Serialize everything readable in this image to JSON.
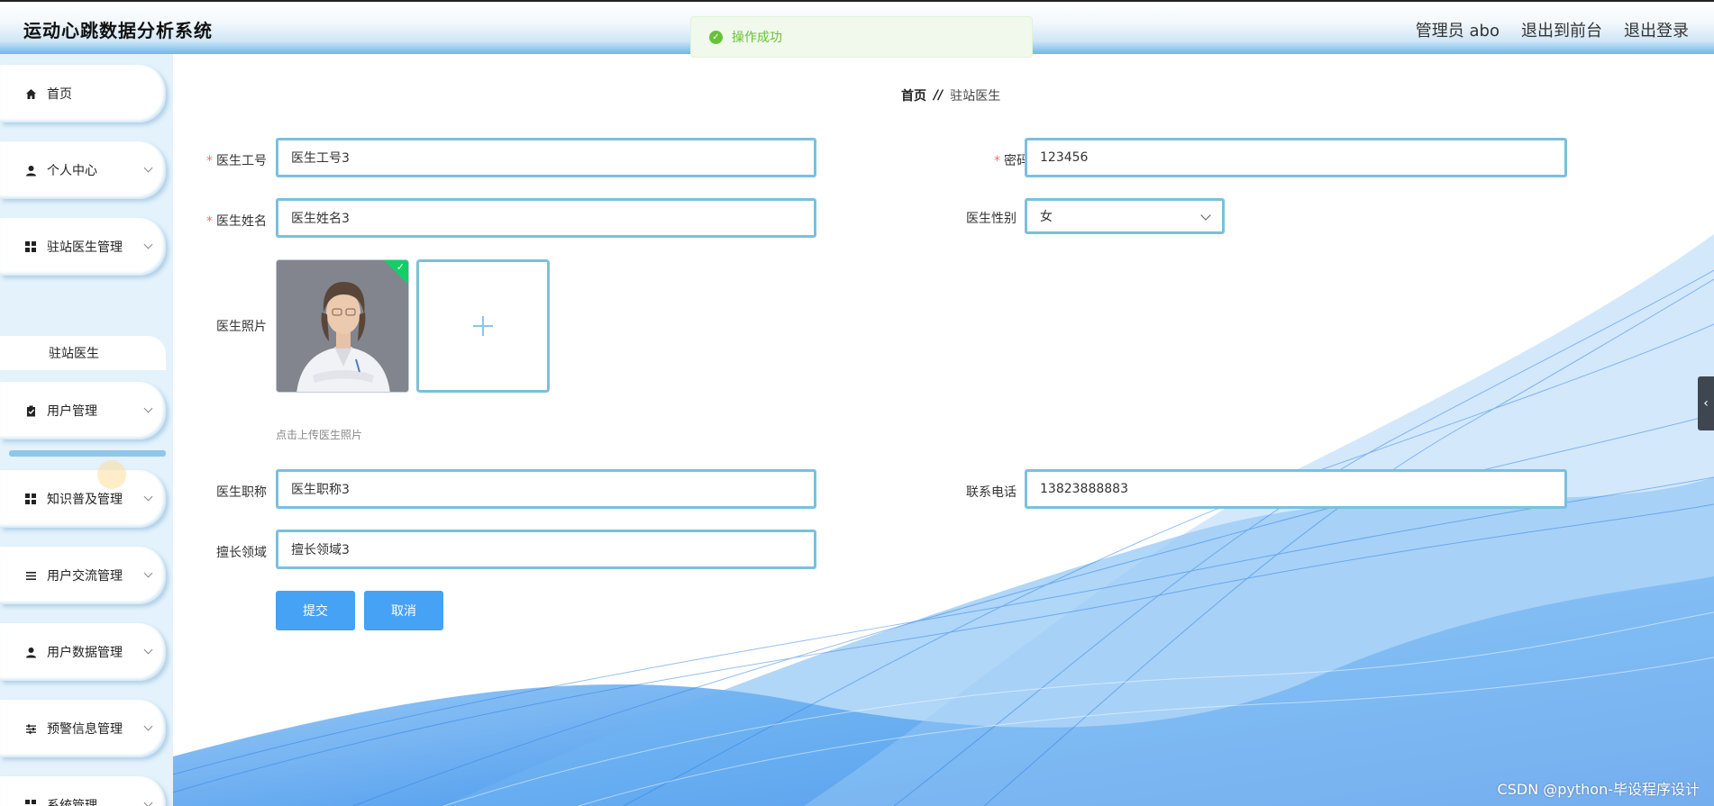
{
  "app": {
    "title": "运动心跳数据分析系统"
  },
  "header": {
    "user_label": "管理员 abo",
    "front_link": "退出到前台",
    "logout_link": "退出登录"
  },
  "toast": {
    "message": "操作成功"
  },
  "sidebar": {
    "items": [
      {
        "label": "首页",
        "icon": "home-icon"
      },
      {
        "label": "个人中心",
        "icon": "user-icon"
      },
      {
        "label": "驻站医生管理",
        "icon": "grid-icon"
      },
      {
        "label": "用户管理",
        "icon": "clipboard-icon"
      },
      {
        "label": "知识普及管理",
        "icon": "grid-icon"
      },
      {
        "label": "用户交流管理",
        "icon": "list-icon"
      },
      {
        "label": "用户数据管理",
        "icon": "user-icon"
      },
      {
        "label": "预警信息管理",
        "icon": "sliders-icon"
      },
      {
        "label": "系统管理",
        "icon": "grid-icon"
      }
    ],
    "sub_item": "驻站医生"
  },
  "breadcrumb": {
    "home": "首页",
    "separator": "//",
    "current": "驻站医生"
  },
  "form": {
    "doctor_id": {
      "label": "医生工号",
      "value": "医生工号3",
      "required": true
    },
    "password": {
      "label": "密码",
      "value": "123456",
      "required": true
    },
    "doctor_name": {
      "label": "医生姓名",
      "value": "医生姓名3",
      "required": true
    },
    "gender": {
      "label": "医生性别",
      "value": "女"
    },
    "photo": {
      "label": "医生照片",
      "tip": "点击上传医生照片"
    },
    "title": {
      "label": "医生职称",
      "value": "医生职称3"
    },
    "phone": {
      "label": "联系电话",
      "value": "13823888883"
    },
    "specialty": {
      "label": "擅长领域",
      "value": "擅长领域3"
    },
    "required_mark": "*",
    "submit_label": "提交",
    "cancel_label": "取消"
  },
  "watermark": "CSDN @python-毕设程序设计",
  "colors": {
    "accent": "#45a2f5",
    "input_border": "#7ac0dd",
    "success": "#67c23a",
    "sidebar_bg": "#e3f2fb"
  }
}
